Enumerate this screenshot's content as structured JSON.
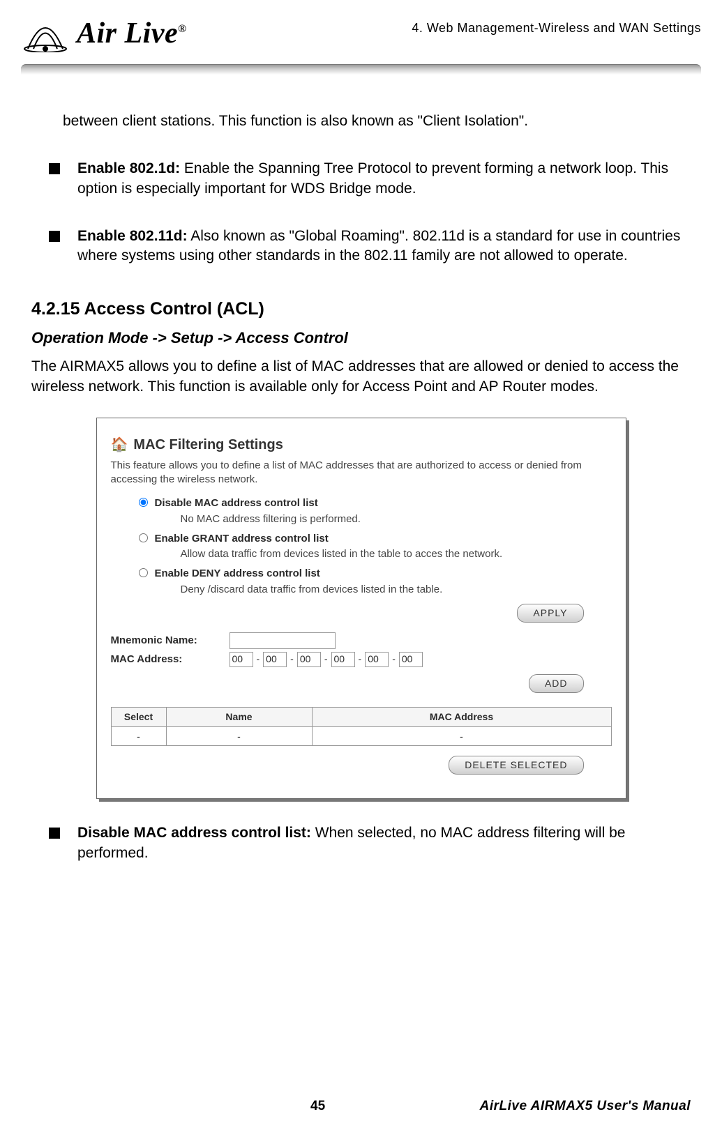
{
  "header": {
    "chapter": "4. Web Management-Wireless and WAN Settings",
    "brand": "Air Live"
  },
  "body": {
    "intro_continuation": "between client stations.    This function is also known as \"Client Isolation\".",
    "bullets_top": [
      {
        "bold": "Enable 802.1d:",
        "rest": " Enable the Spanning Tree Protocol to prevent forming a network loop. This option is especially important for WDS Bridge mode."
      },
      {
        "bold": "Enable 802.11d:",
        "rest": "   Also known as \"Global Roaming\".   802.11d is a standard for use in countries where systems using other standards in the 802.11 family are not allowed to operate."
      }
    ],
    "section_heading": "4.2.15 Access Control (ACL)",
    "sub_heading": "Operation Mode -> Setup -> Access Control",
    "section_desc": "The AIRMAX5 allows you to define a list of MAC addresses that are allowed or denied to access the wireless network.   This function is available only for Access Point and AP Router modes.",
    "bullets_bottom": [
      {
        "bold": "Disable MAC address control list:",
        "rest": " When selected, no MAC address filtering will be performed."
      }
    ]
  },
  "screenshot": {
    "title": "MAC Filtering Settings",
    "intro": "This feature allows you to define a list of MAC addresses that are authorized to access or denied from accessing the wireless network.",
    "radios": [
      {
        "label": "Disable MAC address control list",
        "sub": "No MAC address filtering is performed.",
        "checked": true
      },
      {
        "label": "Enable GRANT address control list",
        "sub": "Allow data traffic from devices listed in the table to acces the network.",
        "checked": false
      },
      {
        "label": "Enable DENY address control list",
        "sub": "Deny /discard data traffic from devices listed in the table.",
        "checked": false
      }
    ],
    "apply_label": "APPLY",
    "mnemonic_label": "Mnemonic Name:",
    "mac_label": "MAC Address:",
    "mac_value": "00",
    "add_label": "ADD",
    "table_headers": [
      "Select",
      "Name",
      "MAC Address"
    ],
    "table_row": [
      "-",
      "-",
      "-"
    ],
    "delete_label": "DELETE SELECTED"
  },
  "footer": {
    "page": "45",
    "manual": "AirLive AIRMAX5 User's Manual"
  }
}
